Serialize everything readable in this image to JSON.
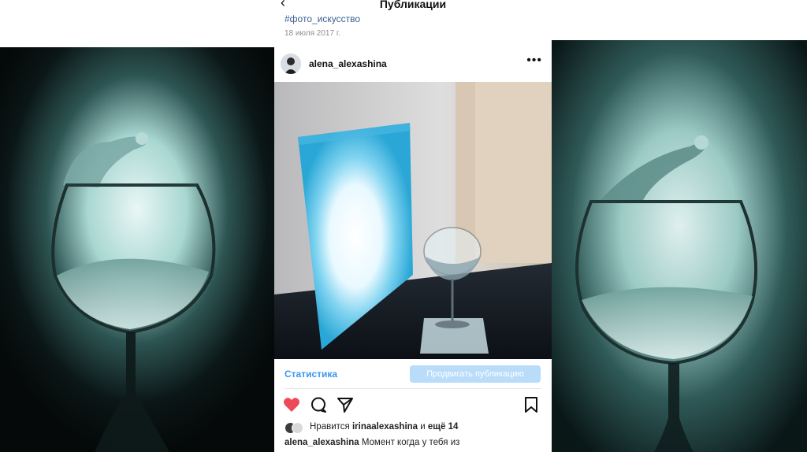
{
  "header": {
    "back_icon": "chevron-left-icon",
    "title": "Публикации"
  },
  "post": {
    "hashtag": "#фото_искусство",
    "date": "18 июля 2017 г.",
    "author": {
      "username": "alena_alexashina",
      "more_icon": "more-horizontal-icon"
    },
    "statistics_label": "Статистика",
    "promote_label": "Продвигать публикацию",
    "actions": {
      "like_icon": "heart-icon",
      "comment_icon": "comment-icon",
      "share_icon": "send-icon",
      "save_icon": "bookmark-icon",
      "like_color": "#ed4956"
    },
    "likes": {
      "prefix": "Нравится",
      "user": "irinaalexashina",
      "conjunction": "и",
      "others": "ещё 14"
    },
    "caption": {
      "username": "alena_alexashina",
      "text": "Момент когда у тебя из"
    }
  },
  "colors": {
    "link_blue": "#3897f0",
    "promote_button_bg": "#b9dcfb",
    "photo_tint": "#9fd3cf"
  }
}
